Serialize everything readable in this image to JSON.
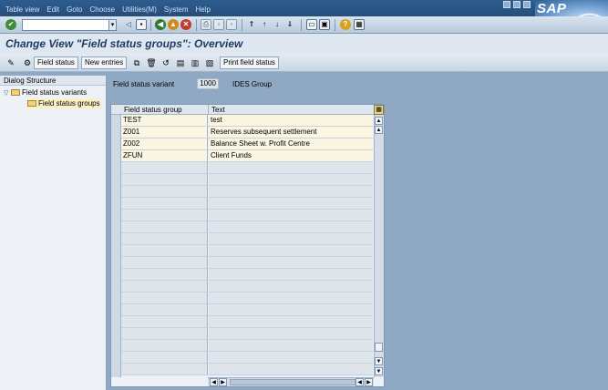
{
  "menu": {
    "items": [
      "Table view",
      "Edit",
      "Goto",
      "Choose",
      "Utilities(M)",
      "System",
      "Help"
    ]
  },
  "logo": {
    "text": "SAP"
  },
  "toolbar": {
    "command_value": "",
    "icons": [
      "enter-icon",
      "save-icon",
      "back-icon",
      "exit-icon",
      "cancel-icon",
      "print-icon",
      "find-icon",
      "find-next-icon",
      "first-page-icon",
      "previous-page-icon",
      "next-page-icon",
      "last-page-icon",
      "create-session-icon",
      "shortcut-icon",
      "help-icon",
      "customize-layout-icon"
    ]
  },
  "title": {
    "text": "Change View \"Field status groups\": Overview"
  },
  "app_toolbar": {
    "field_status_label": "Field status",
    "new_entries_label": "New entries",
    "print_field_status_label": "Print field status"
  },
  "dialog_structure": {
    "header": "Dialog Structure",
    "items": [
      {
        "label": "Field status variants",
        "level": 0,
        "expanded": true
      },
      {
        "label": "Field status groups",
        "level": 1,
        "selected": true
      }
    ]
  },
  "variant": {
    "label": "Field status variant",
    "value": "1000",
    "description": "IDES Group"
  },
  "table": {
    "columns": [
      "Field status group",
      "Text"
    ],
    "rows": [
      {
        "group": "TEST",
        "text": "test"
      },
      {
        "group": "Z001",
        "text": "Reserves subsequent settlement"
      },
      {
        "group": "Z002",
        "text": "Balance Sheet w. Profit Centre"
      },
      {
        "group": "ZFUN",
        "text": "Client Funds"
      }
    ]
  },
  "colors": {
    "menubar": "#2e5d8e",
    "filled_row": "#fbf6e1",
    "empty_row": "#dde4ea",
    "background": "#8fa9c5",
    "title": "#1f3b63"
  }
}
